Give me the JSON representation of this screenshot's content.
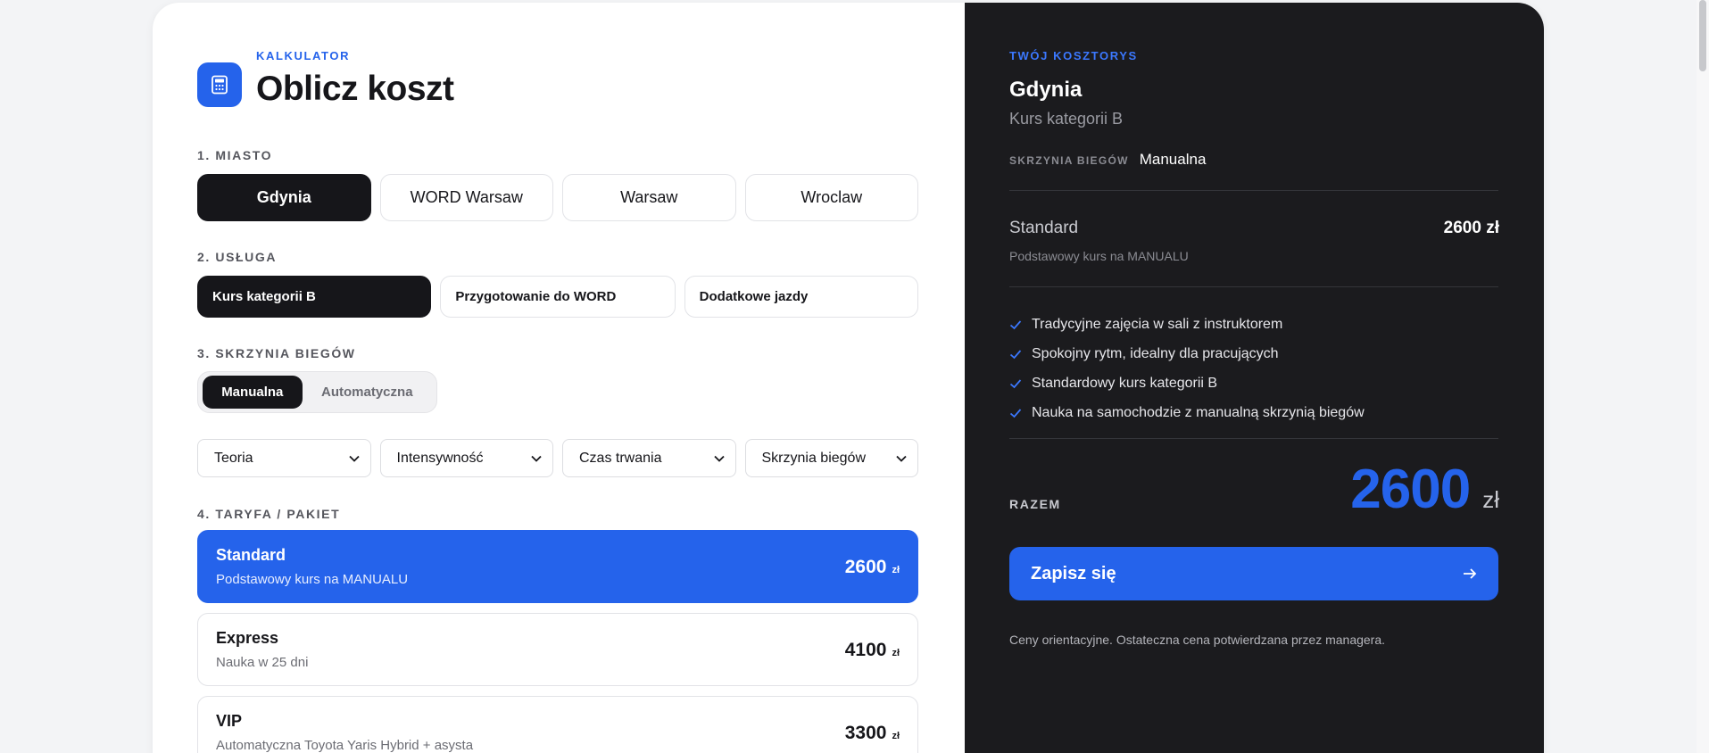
{
  "calculator": {
    "eyebrow": "KALKULATOR",
    "title": "Oblicz koszt"
  },
  "sections": {
    "city": "1. MIASTO",
    "service": "2. USŁUGA",
    "gearbox": "3. SKRZYNIA BIEGÓW",
    "tariff": "4. TARYFA / PAKIET"
  },
  "cities": [
    {
      "label": "Gdynia",
      "active": true
    },
    {
      "label": "WORD Warsaw",
      "active": false
    },
    {
      "label": "Warsaw",
      "active": false
    },
    {
      "label": "Wroclaw",
      "active": false
    }
  ],
  "services": [
    {
      "label": "Kurs kategorii B",
      "active": true
    },
    {
      "label": "Przygotowanie do WORD",
      "active": false
    },
    {
      "label": "Dodatkowe jazdy",
      "active": false
    }
  ],
  "gearbox_toggle": {
    "manual": "Manualna",
    "automatic": "Automatyczna",
    "selected": "Manualna"
  },
  "filters": [
    {
      "label": "Teoria"
    },
    {
      "label": "Intensywność"
    },
    {
      "label": "Czas trwania"
    },
    {
      "label": "Skrzynia biegów"
    }
  ],
  "tariffs": [
    {
      "name": "Standard",
      "desc": "Podstawowy kurs na MANUALU",
      "price": "2600",
      "currency": "zł",
      "active": true
    },
    {
      "name": "Express",
      "desc": "Nauka w 25 dni",
      "price": "4100",
      "currency": "zł",
      "active": false
    },
    {
      "name": "VIP",
      "desc": "Automatyczna Toyota Yaris Hybrid + asysta",
      "price": "3300",
      "currency": "zł",
      "active": false
    }
  ],
  "summary": {
    "eyebrow": "TWÓJ KOSZTORYS",
    "city": "Gdynia",
    "course": "Kurs kategorii B",
    "gear_label": "SKRZYNIA BIEGÓW",
    "gear_value": "Manualna",
    "tariff_name": "Standard",
    "tariff_price": "2600 zł",
    "tariff_desc": "Podstawowy kurs na MANUALU",
    "features": [
      "Tradycyjne zajęcia w sali z instruktorem",
      "Spokojny rytm, idealny dla pracujących",
      "Standardowy kurs kategorii B",
      "Nauka na samochodzie z manualną skrzynią biegów"
    ],
    "total_label": "RAZEM",
    "total_value": "2600",
    "total_currency": "zł",
    "cta_label": "Zapisz się",
    "disclaimer": "Ceny orientacyjne. Ostateczna cena potwierdzana przez managera."
  },
  "colors": {
    "accent": "#2563eb",
    "dark": "#16161a",
    "panel": "#1b1b1e"
  },
  "icons": {
    "calculator": "calculator-icon",
    "chevron": "chevron-down-icon",
    "check": "check-icon",
    "arrow": "arrow-right-icon"
  }
}
